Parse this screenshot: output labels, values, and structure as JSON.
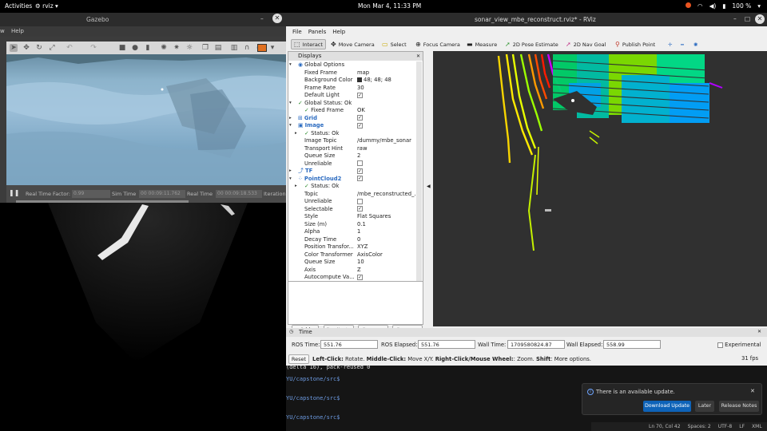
{
  "topbar": {
    "activities": "Activities",
    "app": "rviz",
    "clock": "Mon Mar  4, 11:33 PM",
    "battery": "100 %"
  },
  "gazebo": {
    "title": "Gazebo",
    "menu": "Help",
    "menu_left": "w",
    "real_time_factor_label": "Real Time Factor:",
    "real_time_factor": "0.99",
    "sim_time_label": "Sim Time",
    "sim_time": "00 00:09:11.762",
    "real_time_label": "Real Time",
    "real_time": "00 00:09:18.533",
    "iterations_label": "Iteration"
  },
  "rviz": {
    "title": "sonar_view_mbe_reconstruct.rviz* - RViz",
    "menu": [
      "File",
      "Panels",
      "Help"
    ],
    "tools": [
      "Interact",
      "Move Camera",
      "Select",
      "Focus Camera",
      "Measure",
      "2D Pose Estimate",
      "2D Nav Goal",
      "Publish Point"
    ],
    "displays_title": "Displays",
    "tree": [
      {
        "k": "Global Options",
        "v": "",
        "indent": 1,
        "type": "header"
      },
      {
        "k": "Fixed Frame",
        "v": "map",
        "indent": 2
      },
      {
        "k": "Background Color",
        "v": "48; 48; 48",
        "indent": 2,
        "swatch": "#303030"
      },
      {
        "k": "Frame Rate",
        "v": "30",
        "indent": 2
      },
      {
        "k": "Default Light",
        "v": "✓",
        "indent": 2,
        "check": true
      },
      {
        "k": "Global Status: Ok",
        "v": "",
        "indent": 1,
        "status": true
      },
      {
        "k": "Fixed Frame",
        "v": "OK",
        "indent": 2,
        "status": true
      },
      {
        "k": "Grid",
        "v": "✓",
        "indent": 1,
        "blue": true,
        "check": true
      },
      {
        "k": "Image",
        "v": "✓",
        "indent": 1,
        "blue": true,
        "check": true
      },
      {
        "k": "Status: Ok",
        "v": "",
        "indent": 2,
        "status": true
      },
      {
        "k": "Image Topic",
        "v": "/dummy/mbe_sonar",
        "indent": 2
      },
      {
        "k": "Transport Hint",
        "v": "raw",
        "indent": 2
      },
      {
        "k": "Queue Size",
        "v": "2",
        "indent": 2
      },
      {
        "k": "Unreliable",
        "v": "",
        "indent": 2,
        "check": true
      },
      {
        "k": "TF",
        "v": "✓",
        "indent": 1,
        "blue": true,
        "check": true
      },
      {
        "k": "PointCloud2",
        "v": "✓",
        "indent": 1,
        "blue": true,
        "check": true
      },
      {
        "k": "Status: Ok",
        "v": "",
        "indent": 2,
        "status": true
      },
      {
        "k": "Topic",
        "v": "/mbe_reconstructed_...",
        "indent": 2
      },
      {
        "k": "Unreliable",
        "v": "",
        "indent": 2,
        "check": true
      },
      {
        "k": "Selectable",
        "v": "✓",
        "indent": 2,
        "check": true
      },
      {
        "k": "Style",
        "v": "Flat Squares",
        "indent": 2
      },
      {
        "k": "Size (m)",
        "v": "0.1",
        "indent": 2
      },
      {
        "k": "Alpha",
        "v": "1",
        "indent": 2
      },
      {
        "k": "Decay Time",
        "v": "0",
        "indent": 2
      },
      {
        "k": "Position Transfor...",
        "v": "XYZ",
        "indent": 2
      },
      {
        "k": "Color Transformer",
        "v": "AxisColor",
        "indent": 2
      },
      {
        "k": "Queue Size",
        "v": "10",
        "indent": 2
      },
      {
        "k": "Axis",
        "v": "Z",
        "indent": 2
      },
      {
        "k": "Autocompute Va...",
        "v": "✓",
        "indent": 2,
        "check": true
      }
    ],
    "buttons": [
      "Add",
      "Duplicate",
      "Remove",
      "Rename"
    ],
    "time": {
      "title": "Time",
      "ros_time_label": "ROS Time:",
      "ros_time": "551.76",
      "ros_elapsed_label": "ROS Elapsed:",
      "ros_elapsed": "551.76",
      "wall_time_label": "Wall Time:",
      "wall_time": "1709580824.87",
      "wall_elapsed_label": "Wall Elapsed:",
      "wall_elapsed": "558.99",
      "experimental": "Experimental",
      "reset": "Reset",
      "hint_bold1": "Left-Click:",
      "hint1": " Rotate. ",
      "hint_bold2": "Middle-Click:",
      "hint2": " Move X/Y. ",
      "hint_bold3": "Right-Click/Mouse Wheel:",
      "hint3": ": Zoom. ",
      "hint_bold4": "Shift",
      "hint4": ": More options.",
      "fps": "31 fps"
    }
  },
  "terminal": {
    "lines": [
      "(delta 16), pack-reused 0",
      "YU/capstone/src$",
      "YU/capstone/src$",
      "YU/capstone/src$"
    ]
  },
  "notification": {
    "text": "There is an available update.",
    "download": "Download Update",
    "later": "Later",
    "notes": "Release Notes"
  },
  "editor_status": [
    "Ln 70, Col 42",
    "Spaces: 2",
    "UTF-8",
    "LF",
    "XML"
  ]
}
